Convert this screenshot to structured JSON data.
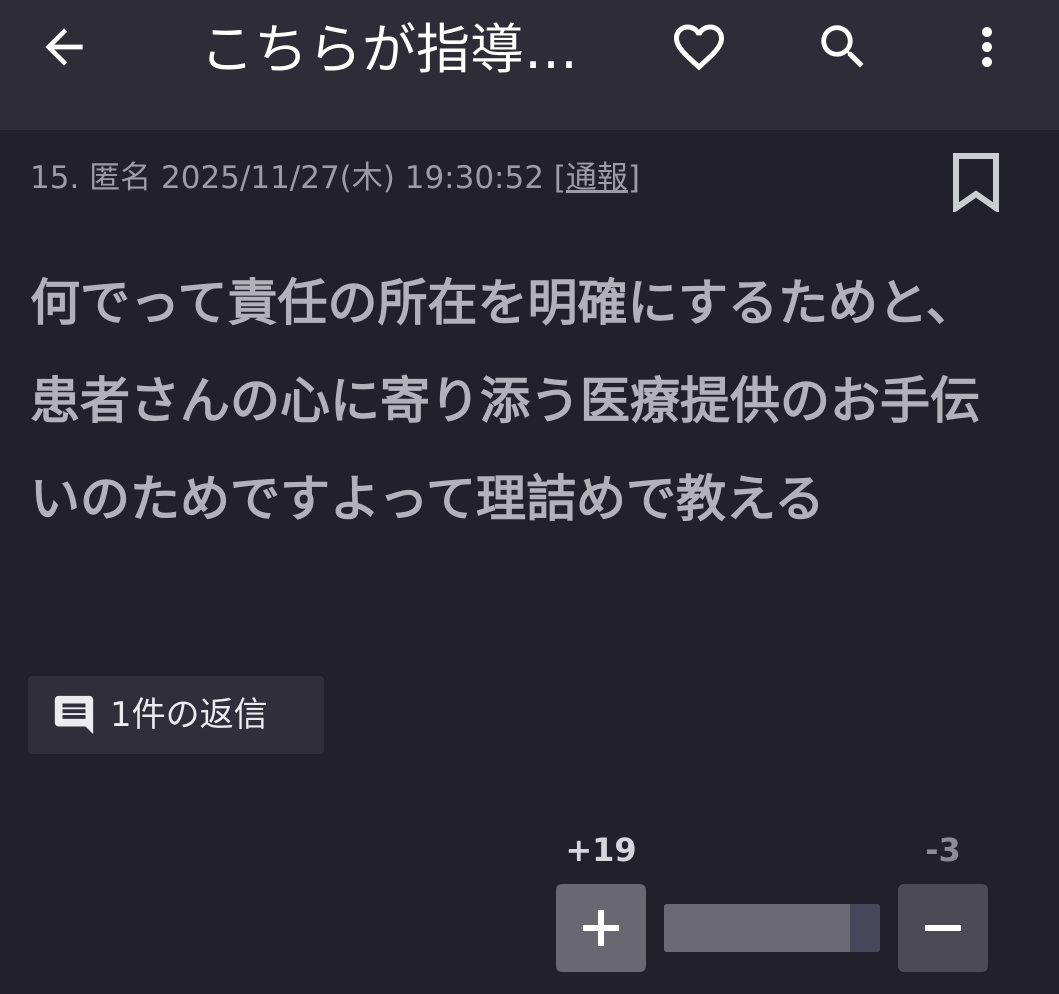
{
  "header": {
    "title": "こちらが指導…",
    "icons": [
      "back-arrow-icon",
      "heart-icon",
      "search-icon",
      "more-vert-icon"
    ]
  },
  "post": {
    "meta_prefix": "15. 匿名 2025/11/27(木) 19:30:52 [",
    "report_label": "通報",
    "meta_suffix": "]",
    "body": "何でって責任の所在を明確にするためと、患者さんの心に寄り添う医療提供のお手伝いのためですよって理詰めで教える",
    "replies_label": "1件の返信"
  },
  "votes": {
    "plus_count": "+19",
    "minus_count": "-3",
    "plus_ratio": 0.86
  },
  "colors": {
    "background": "#22212b",
    "appbar": "#2d2c37",
    "body_text": "#b2b1ba"
  }
}
